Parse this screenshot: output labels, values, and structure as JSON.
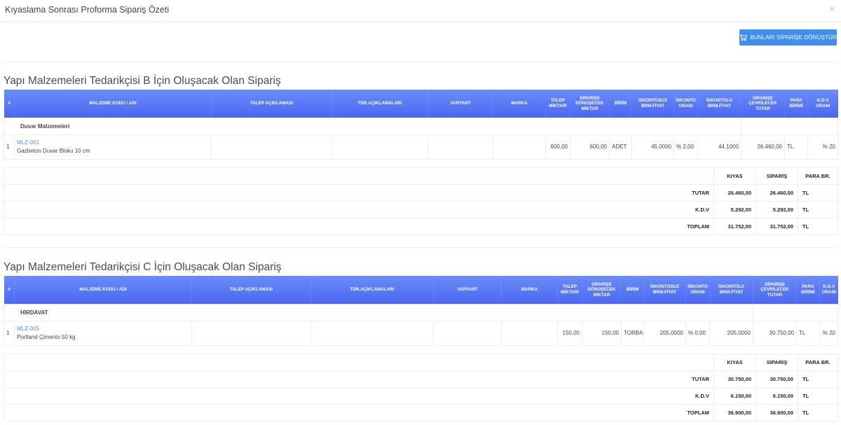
{
  "modal": {
    "title": "Kıyaslama Sonrası Proforma Sipariş Özeti",
    "close_glyph": "×"
  },
  "convert_button": {
    "label": "BUNLARI SİPARİŞE DÖNÜŞTÜR"
  },
  "columns": [
    "#",
    "MALZEME KODU / ADI",
    "TALEP AÇIKLAMASI",
    "TDR.AÇIKLAMALARI",
    "VARYANT",
    "MARKA",
    "TALEP MİKTARI",
    "SİPARİŞE DÖNÜŞECEK MİKTAR",
    "BİRİM",
    "İSKONTOSUZ BRM.FİYAT",
    "İSKONTO ORANI",
    "İSKONTOLU BRM.FİYAT",
    "SİPARİŞE ÇEVRİLECEK TUTAR",
    "PARA BİRİMİ",
    "K.D.V ORANI"
  ],
  "summary_headers": {
    "kiyas": "KIYAS",
    "siparis": "SİPARİŞ",
    "para": "PARA BR."
  },
  "orders": [
    {
      "title": "Yapı Malzemeleri Tedarikçisi B İçin Oluşacak Olan Sipariş",
      "group": "Duvar Malzemeleri",
      "rows": [
        {
          "no": "1",
          "code": "MLZ-001",
          "name": "Gazbeton Duvar Bloku 10 cm",
          "talep_aciklama": "",
          "tdr_aciklama": "",
          "varyant": "",
          "marka": "",
          "talep": "600,00",
          "siparis_miktar": "600,00",
          "birim": "ADET",
          "iskontosuz": "45,0000",
          "iskonto": "% 2,00",
          "iskontolu": "44,1000",
          "tutar": "26.460,00",
          "para": "TL",
          "kdv": "% 20"
        }
      ],
      "summary": [
        {
          "label": "TUTAR",
          "kiyas": "26.460,00",
          "siparis": "26.460,00",
          "para": "TL"
        },
        {
          "label": "K.D.V",
          "kiyas": "5.292,00",
          "siparis": "5.292,00",
          "para": "TL"
        },
        {
          "label": "TOPLAM",
          "kiyas": "31.752,00",
          "siparis": "31.752,00",
          "para": "TL"
        }
      ]
    },
    {
      "title": "Yapı Malzemeleri Tedarikçisi C İçin Oluşacak Olan Sipariş",
      "group": "HIRDAVAT",
      "rows": [
        {
          "no": "1",
          "code": "MLZ-005",
          "name": "Portland Çimento 50 kg",
          "talep_aciklama": "",
          "tdr_aciklama": "",
          "varyant": "",
          "marka": "",
          "talep": "150,00",
          "siparis_miktar": "150,00",
          "birim": "TORBA",
          "iskontosuz": "205,0000",
          "iskonto": "% 0,00",
          "iskontolu": "205,0000",
          "tutar": "30.750,00",
          "para": "TL",
          "kdv": "% 20"
        }
      ],
      "summary": [
        {
          "label": "TUTAR",
          "kiyas": "30.750,00",
          "siparis": "30.750,00",
          "para": "TL"
        },
        {
          "label": "K.D.V",
          "kiyas": "6.150,00",
          "siparis": "6.150,00",
          "para": "TL"
        },
        {
          "label": "TOPLAM",
          "kiyas": "36.900,00",
          "siparis": "36.900,00",
          "para": "TL"
        }
      ]
    }
  ]
}
